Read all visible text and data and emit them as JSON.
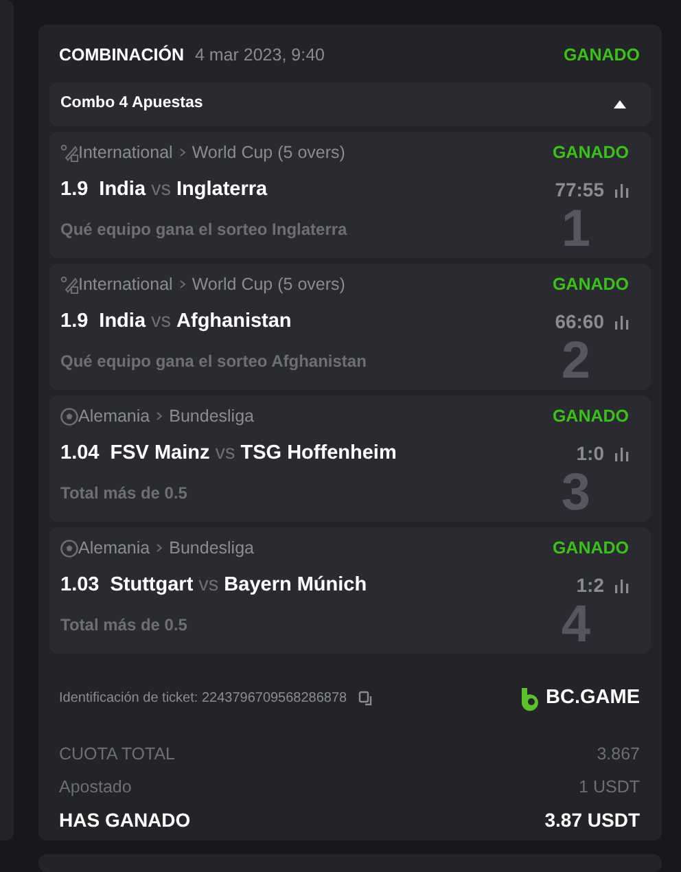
{
  "header": {
    "title": "COMBINACIÓN",
    "date": "4 mar 2023, 9:40",
    "status": "GANADO"
  },
  "combo": {
    "label": "Combo 4 Apuestas",
    "expanded": true
  },
  "legs": [
    {
      "kind": "cricket",
      "league": "International",
      "tournament": "World Cup (5 overs)",
      "status": "GANADO",
      "odds": "1.9",
      "home": "India",
      "vs": "vs",
      "away": "Inglaterra",
      "score": "77:55",
      "market": "Qué equipo gana el sorteo Inglaterra",
      "number": "1"
    },
    {
      "kind": "cricket",
      "league": "International",
      "tournament": "World Cup (5 overs)",
      "status": "GANADO",
      "odds": "1.9",
      "home": "India",
      "vs": "vs",
      "away": "Afghanistan",
      "score": "66:60",
      "market": "Qué equipo gana el sorteo Afghanistan",
      "number": "2"
    },
    {
      "kind": "soccer",
      "league": "Alemania",
      "tournament": "Bundesliga",
      "status": "GANADO",
      "odds": "1.04",
      "home": "FSV Mainz",
      "vs": "vs",
      "away": "TSG Hoffenheim",
      "score": "1:0",
      "market": "Total más de 0.5",
      "number": "3"
    },
    {
      "kind": "soccer",
      "league": "Alemania",
      "tournament": "Bundesliga",
      "status": "GANADO",
      "odds": "1.03",
      "home": "Stuttgart",
      "vs": "vs",
      "away": "Bayern Múnich",
      "score": "1:2",
      "market": "Total más de 0.5",
      "number": "4"
    }
  ],
  "ticket": {
    "label": "Identificación de ticket: 2243796709568286878",
    "brand": "BC.GAME"
  },
  "summary": [
    {
      "kind": "muted",
      "label": "CUOTA TOTAL",
      "value": "3.867"
    },
    {
      "kind": "muted",
      "label": "Apostado",
      "value": "1 USDT"
    },
    {
      "kind": "total",
      "label": "HAS GANADO",
      "value": "3.87 USDT"
    }
  ]
}
